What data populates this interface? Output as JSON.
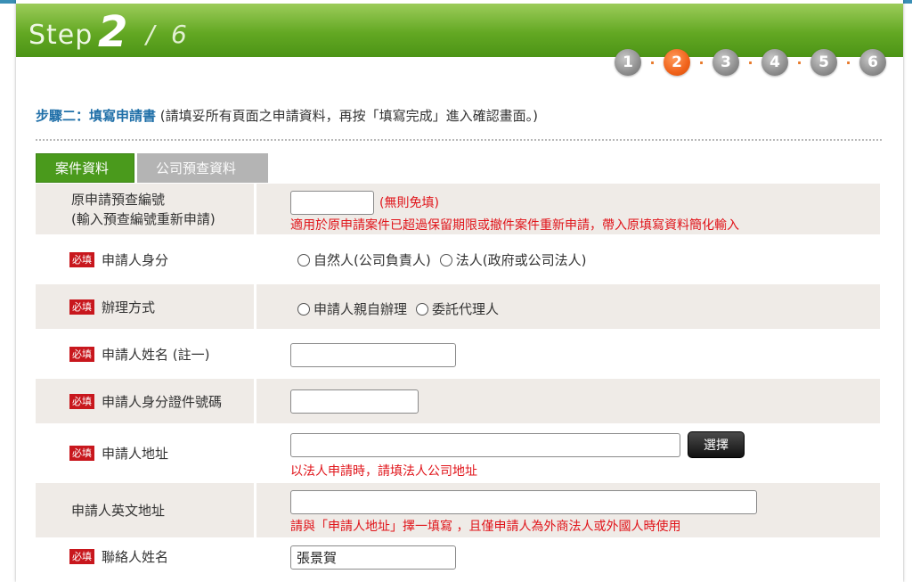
{
  "header": {
    "step_word": "Step",
    "current_step": "2",
    "slash": "/",
    "total_steps": "6",
    "steps": [
      "1",
      "2",
      "3",
      "4",
      "5",
      "6"
    ],
    "active_step_index": 1,
    "step_separator": "·"
  },
  "section": {
    "title": "步驟二：填寫申請書",
    "note": "(請填妥所有頁面之申請資料，再按「填寫完成」進入確認畫面。)"
  },
  "tabs": [
    {
      "label": "案件資料",
      "active": true
    },
    {
      "label": "公司預查資料",
      "active": false
    }
  ],
  "required_badge": "必填",
  "rows": {
    "prev_app": {
      "label_line1": "原申請預查編號",
      "label_line2": "(輸入預查編號重新申請)",
      "value": "",
      "hint_inline": "(無則免填)",
      "hint_below": "適用於原申請案件已超過保留期限或撤件案件重新申請，帶入原填寫資料簡化輸入"
    },
    "identity": {
      "label": "申請人身分",
      "options": [
        "自然人(公司負責人)",
        "法人(政府或公司法人)"
      ]
    },
    "method": {
      "label": "辦理方式",
      "options": [
        "申請人親自辦理",
        "委託代理人"
      ]
    },
    "name": {
      "label": "申請人姓名 (註一)",
      "value": ""
    },
    "id_number": {
      "label": "申請人身分證件號碼",
      "value": ""
    },
    "address": {
      "label": "申請人地址",
      "value": "",
      "button": "選擇",
      "hint": "以法人申請時，請填法人公司地址"
    },
    "en_address": {
      "label": "申請人英文地址",
      "value": "",
      "hint": "請與「申請人地址」擇一填寫 ，且僅申請人為外商法人或外國人時使用"
    },
    "contact": {
      "label": "聯絡人姓名",
      "value": "張景賀"
    }
  },
  "colors": {
    "banner_green": "#63a823",
    "tab_active": "#4a9a1c",
    "tab_inactive": "#b4b4b4",
    "heading_blue": "#1f6fa8",
    "hint_red": "#e0141a",
    "row_shade": "#efebe7",
    "step_active": "#f0621a"
  }
}
